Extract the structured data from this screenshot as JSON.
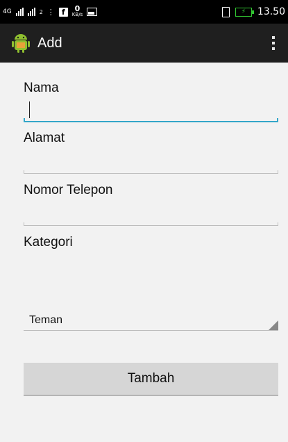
{
  "status_bar": {
    "network": "4G",
    "sim_indicator": "2",
    "net_speed_value": "0",
    "net_speed_unit": "KB/s",
    "time": "13.50",
    "icons": [
      "signal-icon",
      "signal-icon",
      "facebook-icon",
      "image-icon",
      "vibrate-icon",
      "battery-charging-icon"
    ],
    "battery_color": "#32c832"
  },
  "action_bar": {
    "title": "Add",
    "icon": "android-icon",
    "menu_icon": "overflow-menu-icon",
    "background": "#1f1f1f"
  },
  "form": {
    "nama_label": "Nama",
    "nama_value": "",
    "alamat_label": "Alamat",
    "alamat_value": "",
    "telepon_label": "Nomor Telepon",
    "telepon_value": "",
    "kategori_label": "Kategori",
    "kategori_selected": "Teman",
    "accent_color": "#33a6c9"
  },
  "submit_button": {
    "label": "Tambah"
  }
}
